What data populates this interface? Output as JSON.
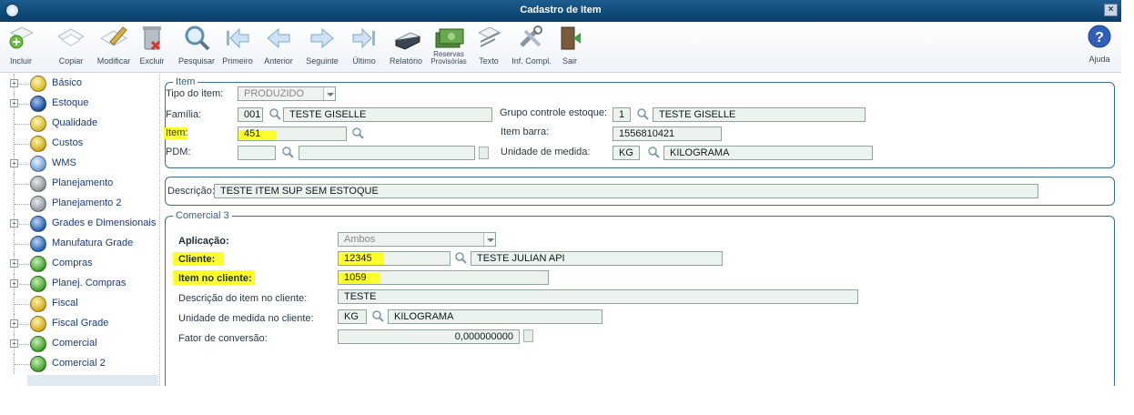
{
  "window": {
    "title": "Cadastro de Item",
    "close_label": "×"
  },
  "toolbar": [
    {
      "id": "incluir",
      "label": "Incluir"
    },
    {
      "id": "copiar",
      "label": "Copiar"
    },
    {
      "id": "modificar",
      "label": "Modificar"
    },
    {
      "id": "excluir",
      "label": "Excluir"
    },
    {
      "id": "pesquisar",
      "label": "Pesquisar"
    },
    {
      "id": "primeiro",
      "label": "Primeiro"
    },
    {
      "id": "anterior",
      "label": "Anterior"
    },
    {
      "id": "seguinte",
      "label": "Seguinte"
    },
    {
      "id": "ultimo",
      "label": "Último"
    },
    {
      "id": "relatorio",
      "label": "Relatório"
    },
    {
      "id": "reservas",
      "label": "Reservas Provisórias",
      "label_line1": "Reservas",
      "label_line2": "Provisórias"
    },
    {
      "id": "texto",
      "label": "Texto"
    },
    {
      "id": "infcompl",
      "label": "Inf. Compl."
    },
    {
      "id": "sair",
      "label": "Sair"
    },
    {
      "id": "ajuda",
      "label": "Ajuda"
    }
  ],
  "sidebar": {
    "items": [
      {
        "label": "Básico",
        "expandable": true,
        "icon": "yellow-circle-icon"
      },
      {
        "label": "Estoque",
        "expandable": true,
        "icon": "blue-grid-icon"
      },
      {
        "label": "Qualidade",
        "expandable": false,
        "icon": "yellow-circle-icon"
      },
      {
        "label": "Custos",
        "expandable": false,
        "icon": "yellow-worker-icon"
      },
      {
        "label": "WMS",
        "expandable": true,
        "icon": "blue-circle-icon"
      },
      {
        "label": "Planejamento",
        "expandable": false,
        "icon": "gray-gear-icon"
      },
      {
        "label": "Planejamento 2",
        "expandable": false,
        "icon": "gray-gear-icon"
      },
      {
        "label": "Grades e Dimensionais",
        "expandable": true,
        "icon": "blue-factory-icon"
      },
      {
        "label": "Manufatura Grade",
        "expandable": false,
        "icon": "blue-factory-icon"
      },
      {
        "label": "Compras",
        "expandable": true,
        "icon": "green-dollar-icon"
      },
      {
        "label": "Planej. Compras",
        "expandable": true,
        "icon": "green-dollar-icon"
      },
      {
        "label": "Fiscal",
        "expandable": false,
        "icon": "yellow-worker-icon"
      },
      {
        "label": "Fiscal Grade",
        "expandable": true,
        "icon": "yellow-worker-icon"
      },
      {
        "label": "Comercial",
        "expandable": true,
        "icon": "green-dollar-icon"
      },
      {
        "label": "Comercial 2",
        "expandable": false,
        "icon": "green-dollar-icon"
      }
    ]
  },
  "item": {
    "legend": "Item",
    "tipo_label": "Tipo do item:",
    "tipo_value": "PRODUZIDO",
    "familia_label": "Família:",
    "familia_code": "001",
    "familia_name": "TESTE GISELLE",
    "grupo_label": "Grupo controle estoque:",
    "grupo_code": "1",
    "grupo_name": "TESTE GISELLE",
    "item_label": "Item:",
    "item_value": "451",
    "barra_label": "Item barra:",
    "barra_value": "1556810421",
    "pdm_label": "PDM:",
    "pdm_code": "",
    "pdm_name": "",
    "unidade_label": "Unidade de medida:",
    "unidade_code": "KG",
    "unidade_name": "KILOGRAMA"
  },
  "descricao": {
    "label": "Descrição:",
    "value": "TESTE ITEM SUP SEM ESTOQUE"
  },
  "comercial": {
    "legend": "Comercial 3",
    "aplicacao_label": "Aplicação:",
    "aplicacao_value": "Ambos",
    "cliente_label": "Cliente:",
    "cliente_code": "12345",
    "cliente_name": "TESTE JULIAN API",
    "item_cliente_label": "Item no cliente:",
    "item_cliente_value": "1059",
    "desc_cliente_label": "Descrição do item no cliente:",
    "desc_cliente_value": "TESTE",
    "unid_cliente_label": "Unidade de medida no cliente:",
    "unid_cliente_code": "KG",
    "unid_cliente_name": "KILOGRAMA",
    "fator_label": "Fator de conversão:",
    "fator_value": "0,000000000"
  },
  "colors": {
    "titlebar": "#0f4a78",
    "highlight": "#ffff2e",
    "field_bg": "#ecf3ee",
    "group_border": "#3a6f8f",
    "nav_text": "#1b3a74"
  }
}
